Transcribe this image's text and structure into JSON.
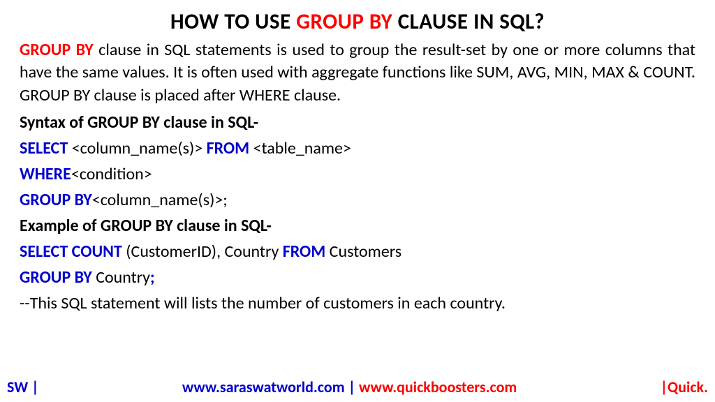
{
  "title": {
    "prefix": "HOW TO USE ",
    "highlight": "GROUP BY",
    "suffix": " CLAUSE IN SQL?"
  },
  "intro": {
    "keyword": "GROUP BY",
    "text": " clause in SQL statements is used to group the result-set by one or more columns that have the same values. It is often used with aggregate functions like SUM, AVG, MIN, MAX & COUNT. GROUP BY clause is placed after WHERE clause."
  },
  "syntax_heading": "Syntax of GROUP BY clause in SQL-",
  "syntax": {
    "line1_kw1": "SELECT",
    "line1_txt1": " <column_name(s)> ",
    "line1_kw2": "FROM",
    "line1_txt2": " <table_name>",
    "line2_kw": "WHERE",
    "line2_txt": "<condition>",
    "line3_kw": "GROUP BY",
    "line3_txt": "<column_name(s)>;"
  },
  "example_heading": "Example of GROUP BY clause in SQL-",
  "example": {
    "line1_kw1": "SELECT COUNT",
    "line1_txt1": " (CustomerID), Country ",
    "line1_kw2": "FROM",
    "line1_txt2": " Customers",
    "line2_kw": "GROUP BY",
    "line2_txt1": " Country",
    "line2_kw2": ";"
  },
  "comment": "--This SQL statement will lists the number of customers in each country.",
  "footer": {
    "left": "SW |",
    "center_blue": "www.saraswatworld.com | ",
    "center_red": "www.quickboosters.com",
    "right": "|Quick."
  }
}
